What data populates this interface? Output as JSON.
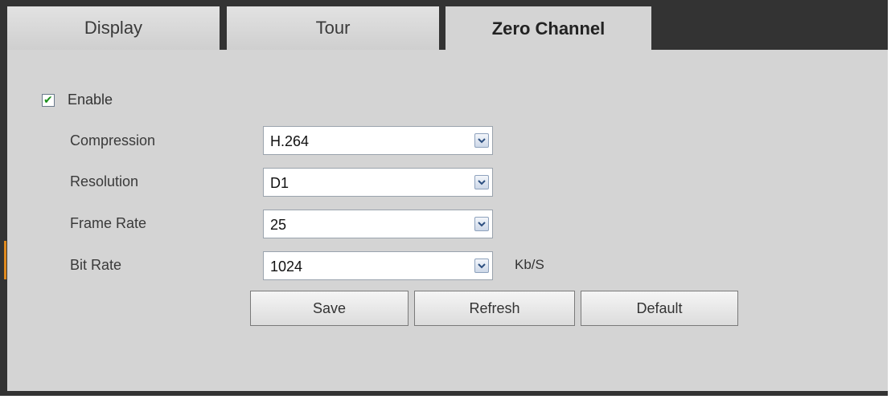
{
  "tabs": [
    {
      "label": "Display"
    },
    {
      "label": "Tour"
    },
    {
      "label": "Zero Channel",
      "active": true
    }
  ],
  "enable": {
    "label": "Enable",
    "checked": true
  },
  "fields": {
    "compression": {
      "label": "Compression",
      "value": "H.264"
    },
    "resolution": {
      "label": "Resolution",
      "value": "D1"
    },
    "frame_rate": {
      "label": "Frame Rate",
      "value": "25"
    },
    "bit_rate": {
      "label": "Bit Rate",
      "value": "1024",
      "unit": "Kb/S"
    }
  },
  "buttons": {
    "save": "Save",
    "refresh": "Refresh",
    "default": "Default"
  },
  "colors": {
    "frame": "#333333",
    "panel": "#d4d4d4",
    "check": "#1a8f1a",
    "marker": "#e08a1e"
  }
}
